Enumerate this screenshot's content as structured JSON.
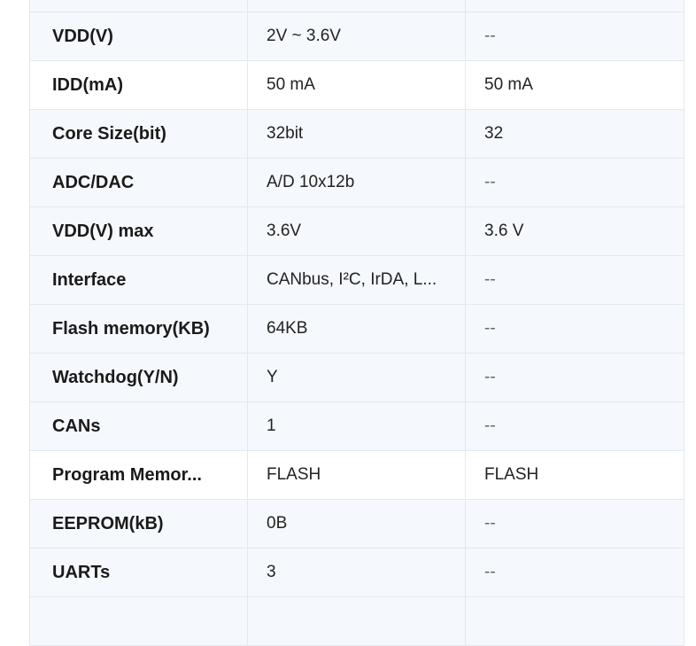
{
  "table": {
    "rows": [
      {
        "label": "",
        "value1": "",
        "value2": "",
        "shaded": true
      },
      {
        "label": "VDD(V)",
        "value1": "2V ~ 3.6V",
        "value2": "--",
        "shaded": true
      },
      {
        "label": "IDD(mA)",
        "value1": "50 mA",
        "value2": "50 mA",
        "shaded": false
      },
      {
        "label": "Core Size(bit)",
        "value1": "32bit",
        "value2": "32",
        "shaded": true
      },
      {
        "label": "ADC/DAC",
        "value1": "A/D 10x12b",
        "value2": "--",
        "shaded": true
      },
      {
        "label": "VDD(V) max",
        "value1": "3.6V",
        "value2": "3.6 V",
        "shaded": true
      },
      {
        "label": "Interface",
        "value1": "CANbus, I²C, IrDA, L...",
        "value2": "--",
        "shaded": true
      },
      {
        "label": "Flash memory(KB)",
        "value1": "64KB",
        "value2": "--",
        "shaded": true
      },
      {
        "label": "Watchdog(Y/N)",
        "value1": "Y",
        "value2": "--",
        "shaded": true
      },
      {
        "label": "CANs",
        "value1": "1",
        "value2": "--",
        "shaded": true
      },
      {
        "label": "Program Memor...",
        "value1": "FLASH",
        "value2": "FLASH",
        "shaded": false
      },
      {
        "label": "EEPROM(kB)",
        "value1": "0B",
        "value2": "--",
        "shaded": true
      },
      {
        "label": "UARTs",
        "value1": "3",
        "value2": "--",
        "shaded": true
      },
      {
        "label": "",
        "value1": "",
        "value2": "",
        "shaded": true
      }
    ]
  }
}
